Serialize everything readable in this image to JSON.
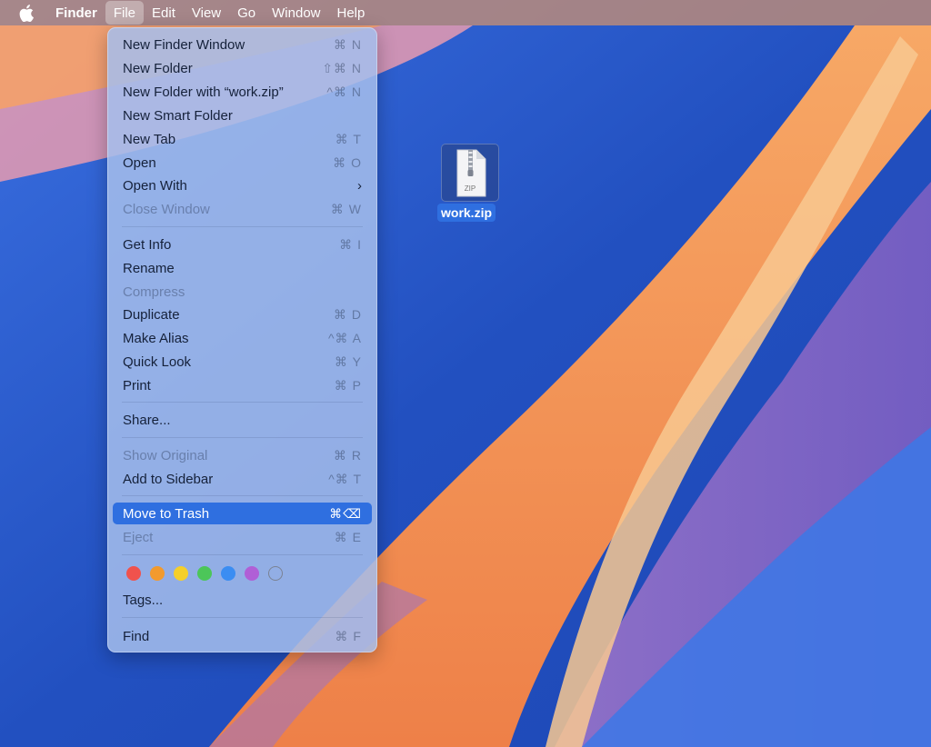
{
  "menubar": {
    "app_name": "Finder",
    "items": [
      "File",
      "Edit",
      "View",
      "Go",
      "Window",
      "Help"
    ],
    "active_item": "File"
  },
  "file_menu": {
    "items": [
      {
        "label": "New Finder Window",
        "shortcut": "⌘ N",
        "disabled": false
      },
      {
        "label": "New Folder",
        "shortcut": "⇧⌘ N",
        "disabled": false
      },
      {
        "label": "New Folder with “work.zip”",
        "shortcut": "^⌘ N",
        "disabled": false
      },
      {
        "label": "New Smart Folder",
        "shortcut": "",
        "disabled": false
      },
      {
        "label": "New Tab",
        "shortcut": "⌘ T",
        "disabled": false
      },
      {
        "label": "Open",
        "shortcut": "⌘ O",
        "disabled": false
      },
      {
        "label": "Open With",
        "shortcut": "›",
        "disabled": false
      },
      {
        "label": "Close Window",
        "shortcut": "⌘ W",
        "disabled": true
      },
      {
        "label": "Get Info",
        "shortcut": "⌘ I",
        "disabled": false
      },
      {
        "label": "Rename",
        "shortcut": "",
        "disabled": false
      },
      {
        "label": "Compress",
        "shortcut": "",
        "disabled": true
      },
      {
        "label": "Duplicate",
        "shortcut": "⌘ D",
        "disabled": false
      },
      {
        "label": "Make Alias",
        "shortcut": "^⌘ A",
        "disabled": false
      },
      {
        "label": "Quick Look",
        "shortcut": "⌘ Y",
        "disabled": false
      },
      {
        "label": "Print",
        "shortcut": "⌘ P",
        "disabled": false
      },
      {
        "label": "Share...",
        "shortcut": "",
        "disabled": false
      },
      {
        "label": "Show Original",
        "shortcut": "⌘ R",
        "disabled": true
      },
      {
        "label": "Add to Sidebar",
        "shortcut": "^⌘ T",
        "disabled": false
      },
      {
        "label": "Move to Trash",
        "shortcut": "⌘⌫",
        "disabled": false,
        "highlighted": true
      },
      {
        "label": "Eject",
        "shortcut": "⌘ E",
        "disabled": true
      },
      {
        "label": "Tags...",
        "shortcut": "",
        "disabled": false
      },
      {
        "label": "Find",
        "shortcut": "⌘ F",
        "disabled": false
      }
    ],
    "tag_colors": [
      "#f0524d",
      "#f29a2e",
      "#f5cf2a",
      "#4cc659",
      "#3b8df2",
      "#b05fd6",
      "none"
    ]
  },
  "desktop": {
    "file": {
      "name": "work.zip",
      "icon_text": "ZIP",
      "icon": "zip-archive-icon"
    }
  },
  "colors": {
    "highlight": "#2f6fe0"
  }
}
